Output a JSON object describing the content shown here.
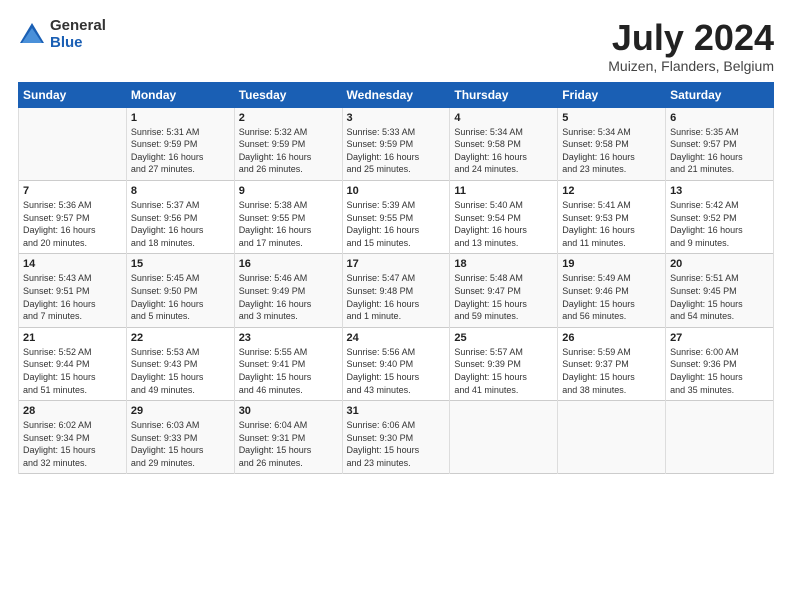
{
  "logo": {
    "general": "General",
    "blue": "Blue"
  },
  "title": "July 2024",
  "subtitle": "Muizen, Flanders, Belgium",
  "headers": [
    "Sunday",
    "Monday",
    "Tuesday",
    "Wednesday",
    "Thursday",
    "Friday",
    "Saturday"
  ],
  "weeks": [
    [
      {
        "day": "",
        "info": ""
      },
      {
        "day": "1",
        "info": "Sunrise: 5:31 AM\nSunset: 9:59 PM\nDaylight: 16 hours\nand 27 minutes."
      },
      {
        "day": "2",
        "info": "Sunrise: 5:32 AM\nSunset: 9:59 PM\nDaylight: 16 hours\nand 26 minutes."
      },
      {
        "day": "3",
        "info": "Sunrise: 5:33 AM\nSunset: 9:59 PM\nDaylight: 16 hours\nand 25 minutes."
      },
      {
        "day": "4",
        "info": "Sunrise: 5:34 AM\nSunset: 9:58 PM\nDaylight: 16 hours\nand 24 minutes."
      },
      {
        "day": "5",
        "info": "Sunrise: 5:34 AM\nSunset: 9:58 PM\nDaylight: 16 hours\nand 23 minutes."
      },
      {
        "day": "6",
        "info": "Sunrise: 5:35 AM\nSunset: 9:57 PM\nDaylight: 16 hours\nand 21 minutes."
      }
    ],
    [
      {
        "day": "7",
        "info": "Sunrise: 5:36 AM\nSunset: 9:57 PM\nDaylight: 16 hours\nand 20 minutes."
      },
      {
        "day": "8",
        "info": "Sunrise: 5:37 AM\nSunset: 9:56 PM\nDaylight: 16 hours\nand 18 minutes."
      },
      {
        "day": "9",
        "info": "Sunrise: 5:38 AM\nSunset: 9:55 PM\nDaylight: 16 hours\nand 17 minutes."
      },
      {
        "day": "10",
        "info": "Sunrise: 5:39 AM\nSunset: 9:55 PM\nDaylight: 16 hours\nand 15 minutes."
      },
      {
        "day": "11",
        "info": "Sunrise: 5:40 AM\nSunset: 9:54 PM\nDaylight: 16 hours\nand 13 minutes."
      },
      {
        "day": "12",
        "info": "Sunrise: 5:41 AM\nSunset: 9:53 PM\nDaylight: 16 hours\nand 11 minutes."
      },
      {
        "day": "13",
        "info": "Sunrise: 5:42 AM\nSunset: 9:52 PM\nDaylight: 16 hours\nand 9 minutes."
      }
    ],
    [
      {
        "day": "14",
        "info": "Sunrise: 5:43 AM\nSunset: 9:51 PM\nDaylight: 16 hours\nand 7 minutes."
      },
      {
        "day": "15",
        "info": "Sunrise: 5:45 AM\nSunset: 9:50 PM\nDaylight: 16 hours\nand 5 minutes."
      },
      {
        "day": "16",
        "info": "Sunrise: 5:46 AM\nSunset: 9:49 PM\nDaylight: 16 hours\nand 3 minutes."
      },
      {
        "day": "17",
        "info": "Sunrise: 5:47 AM\nSunset: 9:48 PM\nDaylight: 16 hours\nand 1 minute."
      },
      {
        "day": "18",
        "info": "Sunrise: 5:48 AM\nSunset: 9:47 PM\nDaylight: 15 hours\nand 59 minutes."
      },
      {
        "day": "19",
        "info": "Sunrise: 5:49 AM\nSunset: 9:46 PM\nDaylight: 15 hours\nand 56 minutes."
      },
      {
        "day": "20",
        "info": "Sunrise: 5:51 AM\nSunset: 9:45 PM\nDaylight: 15 hours\nand 54 minutes."
      }
    ],
    [
      {
        "day": "21",
        "info": "Sunrise: 5:52 AM\nSunset: 9:44 PM\nDaylight: 15 hours\nand 51 minutes."
      },
      {
        "day": "22",
        "info": "Sunrise: 5:53 AM\nSunset: 9:43 PM\nDaylight: 15 hours\nand 49 minutes."
      },
      {
        "day": "23",
        "info": "Sunrise: 5:55 AM\nSunset: 9:41 PM\nDaylight: 15 hours\nand 46 minutes."
      },
      {
        "day": "24",
        "info": "Sunrise: 5:56 AM\nSunset: 9:40 PM\nDaylight: 15 hours\nand 43 minutes."
      },
      {
        "day": "25",
        "info": "Sunrise: 5:57 AM\nSunset: 9:39 PM\nDaylight: 15 hours\nand 41 minutes."
      },
      {
        "day": "26",
        "info": "Sunrise: 5:59 AM\nSunset: 9:37 PM\nDaylight: 15 hours\nand 38 minutes."
      },
      {
        "day": "27",
        "info": "Sunrise: 6:00 AM\nSunset: 9:36 PM\nDaylight: 15 hours\nand 35 minutes."
      }
    ],
    [
      {
        "day": "28",
        "info": "Sunrise: 6:02 AM\nSunset: 9:34 PM\nDaylight: 15 hours\nand 32 minutes."
      },
      {
        "day": "29",
        "info": "Sunrise: 6:03 AM\nSunset: 9:33 PM\nDaylight: 15 hours\nand 29 minutes."
      },
      {
        "day": "30",
        "info": "Sunrise: 6:04 AM\nSunset: 9:31 PM\nDaylight: 15 hours\nand 26 minutes."
      },
      {
        "day": "31",
        "info": "Sunrise: 6:06 AM\nSunset: 9:30 PM\nDaylight: 15 hours\nand 23 minutes."
      },
      {
        "day": "",
        "info": ""
      },
      {
        "day": "",
        "info": ""
      },
      {
        "day": "",
        "info": ""
      }
    ]
  ]
}
